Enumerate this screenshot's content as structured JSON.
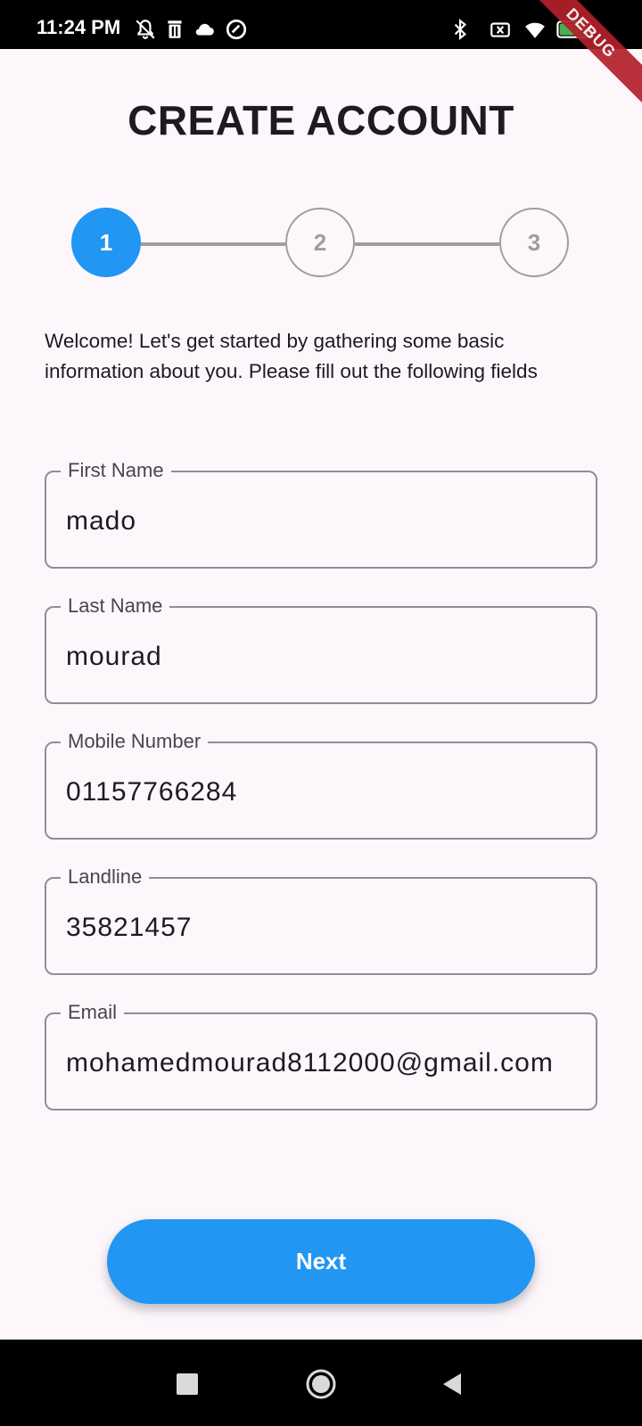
{
  "status_bar": {
    "time": "11:24 PM",
    "left_icons": [
      "notifications-off-icon",
      "trash-icon",
      "cloud-icon",
      "data-saver-icon"
    ],
    "right_icons": [
      "bluetooth-icon",
      "no-sim-icon",
      "wifi-icon",
      "battery-icon"
    ],
    "battery": "100",
    "debug_banner": "DEBUG"
  },
  "title": "CREATE ACCOUNT",
  "stepper": {
    "steps": [
      "1",
      "2",
      "3"
    ],
    "active_step": 1,
    "active_color": "#2196f3",
    "inactive_color": "#9e9e9e"
  },
  "intro_text": "Welcome! Let's get started by gathering some basic information about you. Please fill out the following fields",
  "form": {
    "first_name": {
      "label": "First Name",
      "value": "mado"
    },
    "last_name": {
      "label": "Last Name",
      "value": "mourad"
    },
    "mobile": {
      "label": "Mobile Number",
      "value": "01157766284"
    },
    "landline": {
      "label": "Landline",
      "value": "35821457"
    },
    "email": {
      "label": "Email",
      "value": "mohamedmourad8112000@gmail.com"
    }
  },
  "next_label": "Next",
  "nav_bar": {
    "icons": [
      "recents-icon",
      "home-icon",
      "back-icon"
    ]
  }
}
